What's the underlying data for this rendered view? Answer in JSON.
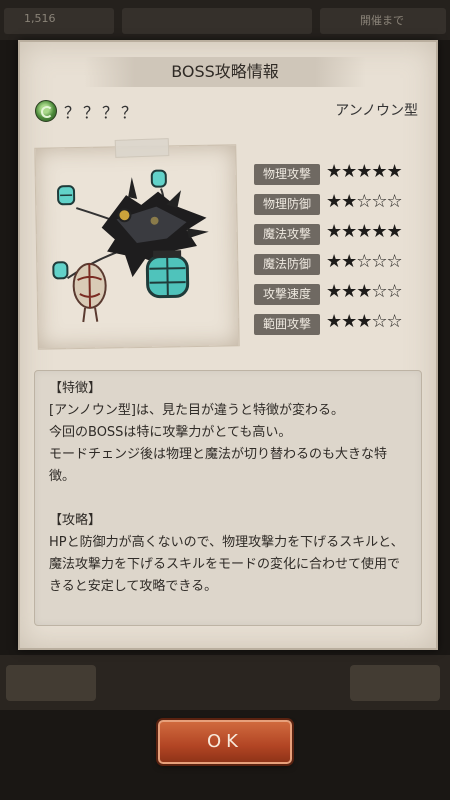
{
  "background": {
    "top_left_text": "1,516",
    "top_right_text": "開催まで"
  },
  "dialog": {
    "title": "BOSS攻略情報",
    "boss_name": "？？？？",
    "boss_type": "アンノウン型",
    "stats": [
      {
        "label": "物理攻撃",
        "rating": 5,
        "stars": "★★★★★"
      },
      {
        "label": "物理防御",
        "rating": 2,
        "stars": "★★☆☆☆"
      },
      {
        "label": "魔法攻撃",
        "rating": 5,
        "stars": "★★★★★"
      },
      {
        "label": "魔法防御",
        "rating": 2,
        "stars": "★★☆☆☆"
      },
      {
        "label": "攻撃速度",
        "rating": 3,
        "stars": "★★★☆☆"
      },
      {
        "label": "範囲攻撃",
        "rating": 3,
        "stars": "★★★☆☆"
      }
    ],
    "description": {
      "feature_heading": "【特徴】",
      "feature_lines": [
        "[アンノウン型]は、見た目が違うと特徴が変わる。",
        "今回のBOSSは特に攻撃力がとても高い。",
        "モードチェンジ後は物理と魔法が切り替わるのも大きな特徴。"
      ],
      "strategy_heading": "【攻略】",
      "strategy_lines": [
        "HPと防御力が高くないので、物理攻撃力を下げるスキルと、魔法攻撃力を下げるスキルをモードの変化に合わせて使用できると安定して攻略できる。"
      ]
    },
    "ok_label": "OK"
  },
  "colors": {
    "panel": "#e8e0d4",
    "stat_label_bg": "#6f6962",
    "ok_button": "#b24524",
    "lantern_glow": "#5fd0c8"
  }
}
